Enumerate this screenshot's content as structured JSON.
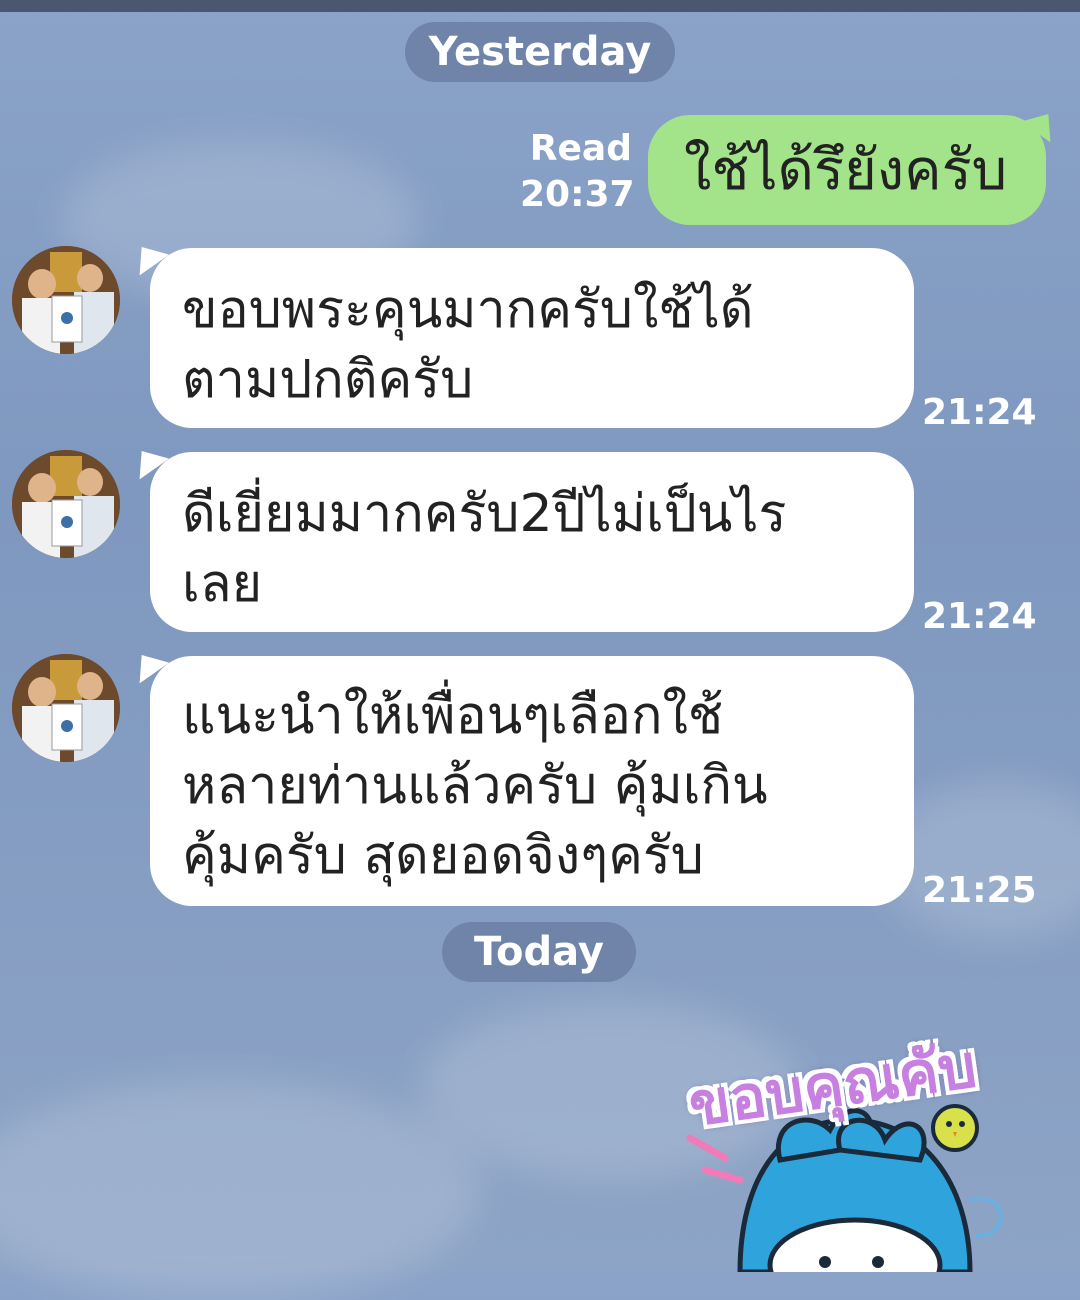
{
  "chat": {
    "date_yesterday": "Yesterday",
    "date_today": "Today",
    "outgoing": {
      "text": "ใช้ได้รึยังครับ",
      "read_label": "Read",
      "time": "20:37"
    },
    "incoming": [
      {
        "line1": "ขอบพระคุนมากครับใช้ได้",
        "line2": "ตามปกติครับ",
        "time": "21:24"
      },
      {
        "line1": "ดีเยี่ยมมากครับ2ปีไม่เป็นไร",
        "line2": "เลย",
        "time": "21:24"
      },
      {
        "line1": "แนะนำให้เพื่อนๆเลือกใช้",
        "line2": "หลายท่านแล้วครับ  คุ้มเกิน",
        "line3": "คุ้มครับ สุดยอดจิงๆครับ",
        "time": "21:25"
      }
    ],
    "sticker": {
      "text": "ขอบคุณคับ",
      "colors": {
        "text_fill": "#c77fe0",
        "text_outline": "#ffffff",
        "character": "#2ea3dc",
        "chick": "#d8e04a"
      }
    }
  },
  "colors": {
    "background": "#8ba3c8",
    "outgoing_bubble": "#a3e48a",
    "incoming_bubble": "#ffffff",
    "date_pill": "#6f84a8"
  }
}
